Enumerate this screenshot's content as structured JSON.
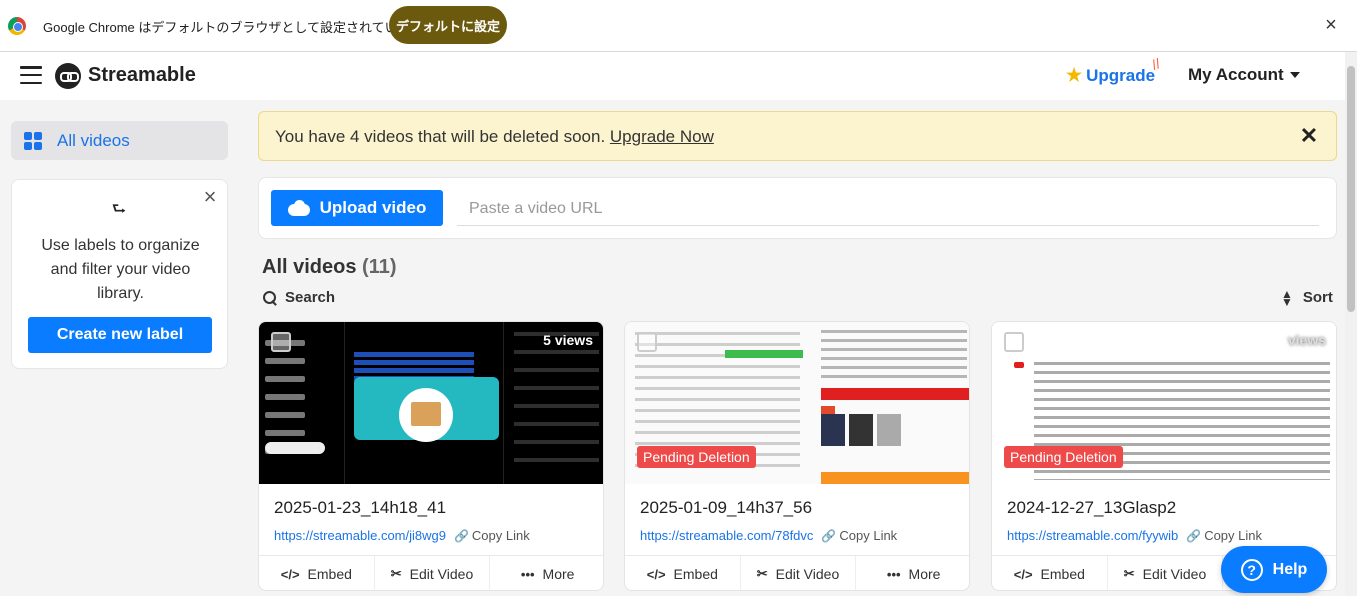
{
  "chrome": {
    "message": "Google Chrome はデフォルトのブラウザとして設定されていません",
    "set_default_label": "デフォルトに設定",
    "close_glyph": "×"
  },
  "header": {
    "logo_text": "Streamable",
    "upgrade_label": "Upgrade",
    "account_label": "My Account"
  },
  "sidebar": {
    "active_item": "All videos",
    "label_card": {
      "text": "Use labels to organize and filter your video library.",
      "button_label": "Create new label",
      "close_glyph": "×"
    }
  },
  "banner": {
    "text": "You have 4 videos that will be deleted soon.",
    "link_label": "Upgrade Now",
    "close_glyph": "✕"
  },
  "upload": {
    "button_label": "Upload video",
    "url_placeholder": "Paste a video URL",
    "url_value": ""
  },
  "videos": {
    "title": "All videos",
    "count": "(11)",
    "search_label": "Search",
    "sort_label": "Sort",
    "items": [
      {
        "title": "2025-01-23_14h18_41",
        "url": "https://streamable.com/ji8wg9",
        "views": "5 views",
        "pending": "",
        "copy_label": "Copy Link"
      },
      {
        "title": "2025-01-09_14h37_56",
        "url": "https://streamable.com/78fdvc",
        "views": "",
        "pending": "Pending Deletion",
        "copy_label": "Copy Link"
      },
      {
        "title": "2024-12-27_13Glasp2",
        "url": "https://streamable.com/fyywib",
        "views": "views",
        "pending": "Pending Deletion",
        "copy_label": "Copy Link"
      }
    ],
    "actions": {
      "embed": "Embed",
      "edit": "Edit Video",
      "more": "More"
    }
  },
  "help": {
    "label": "Help"
  },
  "colors": {
    "accent": "#0a7cff",
    "pending": "#ee4a4a",
    "banner_bg": "#fcf4cf",
    "chrome_button": "#6b5a0d"
  }
}
